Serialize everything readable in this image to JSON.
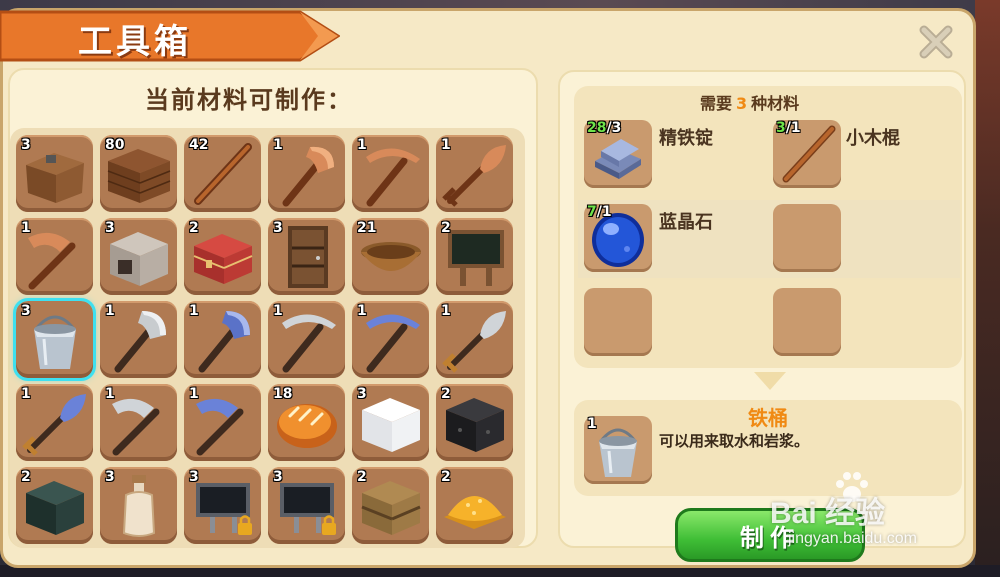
{
  "window": {
    "title": "工具箱",
    "close_icon": "close-x-icon"
  },
  "crafting_list": {
    "heading": "当前材料可制作：",
    "items": [
      {
        "icon": "workbench-icon",
        "count": "3"
      },
      {
        "icon": "wood-planks-icon",
        "count": "80"
      },
      {
        "icon": "wooden-stick-icon",
        "count": "42"
      },
      {
        "icon": "copper-axe-icon",
        "count": "1"
      },
      {
        "icon": "copper-pickaxe-icon",
        "count": "1"
      },
      {
        "icon": "copper-shovel-icon",
        "count": "1"
      },
      {
        "icon": "copper-hoe-icon",
        "count": "1"
      },
      {
        "icon": "stone-furnace-icon",
        "count": "3"
      },
      {
        "icon": "red-chest-icon",
        "count": "2"
      },
      {
        "icon": "wooden-door-icon",
        "count": "3"
      },
      {
        "icon": "wooden-bowl-icon",
        "count": "21"
      },
      {
        "icon": "signboard-icon",
        "count": "2"
      },
      {
        "icon": "iron-bucket-icon",
        "count": "3"
      },
      {
        "icon": "iron-axe-icon",
        "count": "1"
      },
      {
        "icon": "blue-axe-icon",
        "count": "1"
      },
      {
        "icon": "iron-pickaxe-icon",
        "count": "1"
      },
      {
        "icon": "blue-pickaxe-icon",
        "count": "1"
      },
      {
        "icon": "iron-shovel-icon",
        "count": "1"
      },
      {
        "icon": "blue-shovel-icon",
        "count": "1"
      },
      {
        "icon": "iron-hoe-icon",
        "count": "1"
      },
      {
        "icon": "blue-hoe-icon",
        "count": "1"
      },
      {
        "icon": "bread-icon",
        "count": "18"
      },
      {
        "icon": "salt-block-icon",
        "count": "3"
      },
      {
        "icon": "coal-block-icon",
        "count": "2"
      },
      {
        "icon": "dark-stone-block-icon",
        "count": "2"
      },
      {
        "icon": "glass-bottle-icon",
        "count": "3"
      },
      {
        "icon": "locked-sign-icon",
        "count": "3"
      },
      {
        "icon": "locked-sign-2-icon",
        "count": "3"
      },
      {
        "icon": "wooden-crate-icon",
        "count": "2"
      },
      {
        "icon": "gold-powder-icon",
        "count": "2"
      }
    ],
    "selected_index": 12
  },
  "requirements": {
    "prefix": "需要",
    "count": "3",
    "suffix": "种材料",
    "materials": [
      {
        "icon": "refined-iron-ingot-icon",
        "have": "28",
        "need": "/3",
        "name": "精铁锭"
      },
      {
        "icon": "small-stick-icon",
        "have": "3",
        "need": "/1",
        "name": "小木棍"
      },
      {
        "icon": "sapphire-icon",
        "have": "7",
        "need": "/1",
        "name": "蓝晶石"
      }
    ]
  },
  "result": {
    "icon": "iron-bucket-icon",
    "count": "1",
    "name": "铁桶",
    "description": "可以用来取水和岩浆。"
  },
  "make_button": {
    "label": "制作"
  },
  "watermark": {
    "logo": "Bai 经验",
    "url": "jingyan.baidu.com"
  },
  "colors": {
    "accent": "#f08a14",
    "panel": "#f6e9c6",
    "slot": "#b07a52",
    "button": "#3fbe36",
    "select": "#3ee0f0"
  }
}
